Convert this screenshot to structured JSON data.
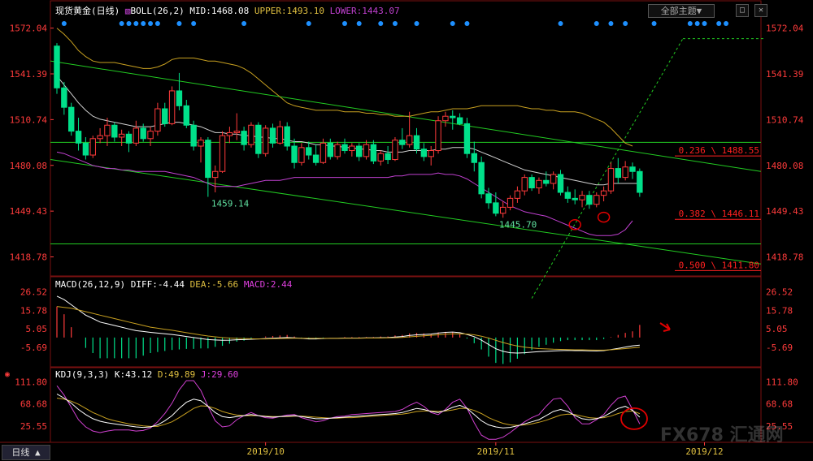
{
  "header": {
    "title": "现货黄金(日线)",
    "boll_label": "BOLL(26,2)",
    "mid_label": "MID:1468.08",
    "upper_label": "UPPER:1493.10",
    "lower_label": "LOWER:1443.07",
    "theme_button": "全部主题▼",
    "period_button": "日线 ▲"
  },
  "macd_header": {
    "name": "MACD(26,12,9)",
    "diff": "DIFF:-4.44",
    "dea": "DEA:-5.66",
    "macd": "MACD:2.44"
  },
  "kdj_header": {
    "name": "KDJ(9,3,3)",
    "k": "K:43.12",
    "d": "D:49.89",
    "j": "J:29.60"
  },
  "watermark": "FX678 汇通网",
  "colors": {
    "up": "#ff3b3b",
    "down": "#00e08a",
    "mid": "#d0d0d0",
    "upper": "#c8a020",
    "lower": "#c040d0",
    "trend": "#22cc22",
    "fib": "#ff2020",
    "axis": "#ff3b3b",
    "dots": "#1e90ff",
    "annot": "#e00000"
  },
  "chart_data": [
    {
      "type": "candlestick",
      "title": "现货黄金(日线)",
      "y_ticks": [
        "1572.04",
        "1541.39",
        "1510.74",
        "1480.08",
        "1449.43",
        "1418.78"
      ],
      "ylim": [
        1406,
        1580
      ],
      "x_ticks": [
        {
          "label": "2019/10",
          "index": 29
        },
        {
          "label": "2019/11",
          "index": 61
        },
        {
          "label": "2019/12",
          "index": 90
        }
      ],
      "candles": [
        [
          1560,
          1562,
          1528,
          1532
        ],
        [
          1532,
          1536,
          1514,
          1519
        ],
        [
          1519,
          1522,
          1500,
          1503
        ],
        [
          1503,
          1512,
          1490,
          1495
        ],
        [
          1495,
          1499,
          1484,
          1487
        ],
        [
          1487,
          1500,
          1485,
          1498
        ],
        [
          1498,
          1505,
          1495,
          1500
        ],
        [
          1500,
          1512,
          1493,
          1507
        ],
        [
          1507,
          1509,
          1496,
          1499
        ],
        [
          1499,
          1504,
          1493,
          1501
        ],
        [
          1501,
          1503,
          1489,
          1495
        ],
        [
          1495,
          1510,
          1493,
          1505
        ],
        [
          1505,
          1508,
          1496,
          1498
        ],
        [
          1498,
          1506,
          1493,
          1503
        ],
        [
          1503,
          1522,
          1500,
          1518
        ],
        [
          1518,
          1522,
          1506,
          1508
        ],
        [
          1508,
          1533,
          1507,
          1530
        ],
        [
          1530,
          1542,
          1517,
          1520
        ],
        [
          1520,
          1524,
          1505,
          1507
        ],
        [
          1507,
          1510,
          1490,
          1493
        ],
        [
          1493,
          1499,
          1482,
          1497
        ],
        [
          1497,
          1499,
          1459,
          1472
        ],
        [
          1472,
          1480,
          1462,
          1476
        ],
        [
          1476,
          1503,
          1475,
          1500
        ],
        [
          1500,
          1506,
          1495,
          1502
        ],
        [
          1502,
          1515,
          1497,
          1503
        ],
        [
          1503,
          1506,
          1490,
          1494
        ],
        [
          1494,
          1509,
          1492,
          1507
        ],
        [
          1507,
          1509,
          1485,
          1488
        ],
        [
          1488,
          1507,
          1486,
          1505
        ],
        [
          1505,
          1508,
          1492,
          1495
        ],
        [
          1495,
          1510,
          1494,
          1506
        ],
        [
          1506,
          1509,
          1490,
          1493
        ],
        [
          1493,
          1498,
          1478,
          1482
        ],
        [
          1482,
          1495,
          1480,
          1492
        ],
        [
          1492,
          1496,
          1484,
          1487
        ],
        [
          1487,
          1494,
          1480,
          1482
        ],
        [
          1482,
          1498,
          1481,
          1495
        ],
        [
          1495,
          1498,
          1484,
          1486
        ],
        [
          1486,
          1496,
          1484,
          1494
        ],
        [
          1494,
          1498,
          1488,
          1490
        ],
        [
          1490,
          1495,
          1486,
          1493
        ],
        [
          1493,
          1495,
          1483,
          1486
        ],
        [
          1486,
          1497,
          1484,
          1494
        ],
        [
          1494,
          1497,
          1481,
          1483
        ],
        [
          1483,
          1490,
          1480,
          1488
        ],
        [
          1488,
          1493,
          1481,
          1484
        ],
        [
          1484,
          1499,
          1483,
          1497
        ],
        [
          1497,
          1505,
          1491,
          1494
        ],
        [
          1494,
          1516,
          1492,
          1500
        ],
        [
          1500,
          1505,
          1488,
          1491
        ],
        [
          1491,
          1495,
          1483,
          1486
        ],
        [
          1486,
          1493,
          1480,
          1490
        ],
        [
          1490,
          1513,
          1488,
          1510
        ],
        [
          1510,
          1516,
          1506,
          1513
        ],
        [
          1513,
          1517,
          1504,
          1512
        ],
        [
          1512,
          1515,
          1507,
          1508
        ],
        [
          1508,
          1512,
          1485,
          1488
        ],
        [
          1488,
          1496,
          1476,
          1482
        ],
        [
          1482,
          1486,
          1458,
          1461
        ],
        [
          1461,
          1465,
          1451,
          1455
        ],
        [
          1455,
          1462,
          1446,
          1448
        ],
        [
          1448,
          1456,
          1445,
          1452
        ],
        [
          1452,
          1460,
          1450,
          1458
        ],
        [
          1458,
          1466,
          1455,
          1463
        ],
        [
          1463,
          1474,
          1460,
          1472
        ],
        [
          1472,
          1474,
          1463,
          1465
        ],
        [
          1465,
          1472,
          1461,
          1470
        ],
        [
          1470,
          1476,
          1466,
          1468
        ],
        [
          1468,
          1476,
          1464,
          1474
        ],
        [
          1474,
          1477,
          1460,
          1462
        ],
        [
          1462,
          1466,
          1455,
          1458
        ],
        [
          1458,
          1464,
          1454,
          1457
        ],
        [
          1457,
          1463,
          1452,
          1460
        ],
        [
          1460,
          1463,
          1451,
          1454
        ],
        [
          1454,
          1462,
          1452,
          1460
        ],
        [
          1460,
          1466,
          1456,
          1463
        ],
        [
          1463,
          1482,
          1461,
          1478
        ],
        [
          1478,
          1485,
          1468,
          1472
        ],
        [
          1472,
          1483,
          1470,
          1479
        ],
        [
          1479,
          1482,
          1471,
          1476
        ],
        [
          1476,
          1478,
          1459,
          1462
        ]
      ],
      "mid": [
        1540,
        1534,
        1528,
        1522,
        1517,
        1513,
        1511,
        1510,
        1509,
        1508,
        1507,
        1506,
        1506,
        1506,
        1507,
        1508,
        1509,
        1509,
        1508,
        1507,
        1506,
        1504,
        1502,
        1502,
        1501,
        1501,
        1500,
        1500,
        1499,
        1499,
        1498,
        1498,
        1497,
        1496,
        1496,
        1495,
        1494,
        1494,
        1493,
        1493,
        1492,
        1492,
        1491,
        1491,
        1490,
        1490,
        1489,
        1489,
        1489,
        1490,
        1490,
        1490,
        1490,
        1491,
        1491,
        1492,
        1492,
        1492,
        1491,
        1489,
        1487,
        1485,
        1483,
        1481,
        1479,
        1477,
        1476,
        1475,
        1474,
        1473,
        1472,
        1471,
        1470,
        1469,
        1468,
        1467,
        1467,
        1468,
        1468,
        1468,
        1468,
        1468
      ],
      "upper": [
        1572,
        1568,
        1563,
        1557,
        1553,
        1550,
        1549,
        1549,
        1549,
        1548,
        1547,
        1546,
        1545,
        1545,
        1546,
        1548,
        1551,
        1552,
        1552,
        1552,
        1551,
        1550,
        1550,
        1549,
        1548,
        1547,
        1545,
        1542,
        1538,
        1534,
        1530,
        1526,
        1522,
        1520,
        1519,
        1518,
        1517,
        1517,
        1517,
        1517,
        1516,
        1516,
        1516,
        1515,
        1515,
        1514,
        1514,
        1513,
        1513,
        1513,
        1514,
        1515,
        1516,
        1516,
        1517,
        1518,
        1518,
        1518,
        1519,
        1520,
        1520,
        1520,
        1520,
        1520,
        1520,
        1519,
        1518,
        1518,
        1517,
        1517,
        1516,
        1516,
        1516,
        1515,
        1513,
        1511,
        1509,
        1505,
        1500,
        1495,
        1493
      ],
      "lower": [
        1489,
        1488,
        1486,
        1484,
        1482,
        1480,
        1479,
        1478,
        1478,
        1477,
        1477,
        1476,
        1476,
        1476,
        1476,
        1476,
        1475,
        1474,
        1473,
        1472,
        1470,
        1468,
        1466,
        1466,
        1466,
        1466,
        1467,
        1468,
        1469,
        1470,
        1470,
        1470,
        1471,
        1472,
        1472,
        1472,
        1472,
        1472,
        1472,
        1472,
        1472,
        1472,
        1472,
        1472,
        1472,
        1472,
        1472,
        1473,
        1473,
        1474,
        1474,
        1474,
        1474,
        1475,
        1474,
        1474,
        1473,
        1471,
        1468,
        1465,
        1462,
        1459,
        1456,
        1453,
        1451,
        1449,
        1448,
        1447,
        1446,
        1444,
        1442,
        1440,
        1438,
        1436,
        1434,
        1433,
        1433,
        1433,
        1434,
        1437,
        1443
      ],
      "annotations": [
        {
          "text": "1459.14",
          "index": 21,
          "price": 1459
        },
        {
          "text": "1445.70",
          "index": 61,
          "price": 1445
        }
      ],
      "fibonacci": [
        {
          "label": "0.236 \\ 1488.55",
          "price": 1488.55
        },
        {
          "label": "0.382 \\ 1446.11",
          "price": 1446.11
        },
        {
          "label": "0.500 \\ 1411.80",
          "price": 1411.8
        }
      ],
      "horizontal_lines": [
        1495.5,
        1427.5
      ],
      "trend_lines": [
        {
          "from": [
            0,
            1550
          ],
          "to": [
            1000,
            1476
          ]
        },
        {
          "from": [
            0,
            1484
          ],
          "to": [
            1000,
            1414
          ]
        }
      ],
      "dashed_line": {
        "from": [
          66,
          1391
        ],
        "to": [
          87,
          1565
        ],
        "flat_to": 1000
      },
      "signal_dots_indices": [
        1,
        9,
        10,
        11,
        12,
        13,
        14,
        17,
        19,
        26,
        35,
        40,
        42,
        45,
        47,
        50,
        55,
        57,
        70,
        75,
        77,
        79,
        83,
        88,
        89,
        90,
        92,
        93
      ]
    },
    {
      "type": "macd",
      "title": "MACD(26,12,9)",
      "y_ticks": [
        "26.52",
        "15.78",
        "5.05",
        "-5.69"
      ],
      "ylim": [
        -17,
        31
      ],
      "diff": [
        24,
        22,
        19,
        16,
        13,
        11,
        9,
        8,
        7,
        6,
        5,
        4,
        3.5,
        3,
        2.6,
        2.2,
        1.8,
        1.2,
        0.6,
        0,
        -0.6,
        -1.2,
        -1.4,
        -1.6,
        -1.5,
        -1.3,
        -1.2,
        -1.0,
        -0.8,
        -0.6,
        -0.4,
        -0.2,
        0.0,
        -0.2,
        -0.5,
        -0.8,
        -0.8,
        -0.6,
        -0.5,
        -0.5,
        -0.3,
        -0.3,
        -0.3,
        -0.2,
        -0.2,
        -0.1,
        0.0,
        0.3,
        0.6,
        1.2,
        1.6,
        1.8,
        2.0,
        2.6,
        3.0,
        3.2,
        2.8,
        1.8,
        0.5,
        -1.5,
        -4.0,
        -6.5,
        -8.0,
        -8.8,
        -9.0,
        -8.8,
        -8.5,
        -8.2,
        -8.0,
        -7.8,
        -7.6,
        -7.5,
        -7.6,
        -7.6,
        -7.7,
        -7.8,
        -7.6,
        -7.0,
        -6.3,
        -5.5,
        -4.8,
        -4.44
      ],
      "dea": [
        18,
        17.5,
        17,
        16,
        15,
        14,
        13,
        12,
        11,
        10,
        9,
        8,
        7,
        6,
        5.4,
        4.8,
        4.2,
        3.5,
        2.8,
        2.2,
        1.5,
        0.9,
        0.4,
        0.0,
        -0.3,
        -0.5,
        -0.6,
        -0.7,
        -0.8,
        -0.8,
        -0.7,
        -0.6,
        -0.5,
        -0.4,
        -0.4,
        -0.5,
        -0.5,
        -0.5,
        -0.5,
        -0.5,
        -0.4,
        -0.4,
        -0.4,
        -0.3,
        -0.3,
        -0.3,
        -0.2,
        -0.1,
        0.1,
        0.4,
        0.7,
        1.0,
        1.3,
        1.6,
        1.9,
        2.1,
        2.2,
        2.0,
        1.6,
        0.8,
        -0.3,
        -1.6,
        -2.9,
        -4.0,
        -4.9,
        -5.6,
        -6.1,
        -6.4,
        -6.6,
        -6.8,
        -6.9,
        -7.0,
        -7.1,
        -7.1,
        -7.2,
        -7.3,
        -7.3,
        -7.1,
        -6.8,
        -6.4,
        -6.0,
        -5.66
      ],
      "hist": [
        6,
        4.5,
        2,
        0,
        -2,
        -3,
        -4,
        -4,
        -4,
        -4,
        -4,
        -4,
        -3.5,
        -3,
        -2.8,
        -2.6,
        -2.4,
        -2.3,
        -2.2,
        -2.2,
        -2.1,
        -2.1,
        -1.8,
        -1.6,
        -1.2,
        -0.8,
        -0.6,
        -0.3,
        0.0,
        0.2,
        0.3,
        0.4,
        0.5,
        0.2,
        -0.1,
        -0.3,
        -0.3,
        -0.1,
        0.0,
        0.0,
        0.1,
        0.1,
        0.1,
        0.1,
        0.1,
        0.2,
        0.2,
        0.4,
        0.5,
        0.8,
        0.9,
        0.8,
        0.7,
        1.0,
        1.1,
        1.1,
        0.6,
        -0.2,
        -1.1,
        -2.3,
        -3.7,
        -4.9,
        -5.1,
        -4.8,
        -4.1,
        -3.2,
        -2.4,
        -1.8,
        -1.4,
        -1.0,
        -0.7,
        -0.5,
        -0.5,
        -0.5,
        -0.5,
        -0.5,
        -0.3,
        0.1,
        0.5,
        0.9,
        1.2,
        2.44
      ]
    },
    {
      "type": "kdj",
      "title": "KDJ(9,3,3)",
      "y_ticks": [
        "111.80",
        "68.68",
        "25.55"
      ],
      "ylim": [
        -6,
        125
      ],
      "k": [
        88,
        80,
        70,
        58,
        48,
        40,
        35,
        32,
        30,
        28,
        26,
        24,
        23,
        24,
        28,
        36,
        46,
        60,
        72,
        78,
        75,
        64,
        52,
        44,
        42,
        44,
        46,
        48,
        46,
        44,
        43,
        44,
        45,
        46,
        44,
        42,
        40,
        40,
        41,
        42,
        43,
        44,
        45,
        46,
        47,
        48,
        49,
        50,
        52,
        56,
        60,
        58,
        54,
        52,
        56,
        62,
        66,
        60,
        48,
        36,
        28,
        24,
        22,
        23,
        26,
        30,
        34,
        38,
        46,
        54,
        58,
        54,
        46,
        40,
        38,
        40,
        44,
        52,
        60,
        64,
        56,
        43
      ],
      "d": [
        80,
        78,
        74,
        68,
        60,
        52,
        46,
        40,
        36,
        33,
        30,
        28,
        26,
        25,
        25,
        29,
        34,
        42,
        51,
        60,
        65,
        64,
        60,
        54,
        50,
        47,
        46,
        46,
        46,
        45,
        44,
        44,
        44,
        45,
        45,
        44,
        43,
        42,
        41,
        41,
        42,
        42,
        43,
        44,
        45,
        46,
        47,
        48,
        49,
        51,
        54,
        55,
        55,
        54,
        55,
        57,
        60,
        60,
        56,
        50,
        42,
        36,
        31,
        28,
        27,
        28,
        30,
        33,
        37,
        42,
        47,
        49,
        48,
        45,
        42,
        41,
        42,
        45,
        50,
        54,
        55,
        49.89
      ],
      "j": [
        104,
        86,
        62,
        38,
        24,
        16,
        13,
        16,
        18,
        18,
        18,
        16,
        17,
        22,
        34,
        50,
        70,
        96,
        114,
        114,
        95,
        64,
        36,
        24,
        26,
        38,
        46,
        52,
        46,
        42,
        41,
        44,
        47,
        48,
        42,
        38,
        34,
        36,
        41,
        44,
        45,
        48,
        49,
        50,
        51,
        52,
        53,
        54,
        58,
        66,
        72,
        64,
        52,
        48,
        58,
        72,
        78,
        60,
        32,
        8,
        0,
        0,
        4,
        13,
        24,
        34,
        42,
        48,
        64,
        78,
        80,
        64,
        42,
        30,
        30,
        38,
        48,
        66,
        80,
        84,
        58,
        29.6
      ]
    }
  ]
}
